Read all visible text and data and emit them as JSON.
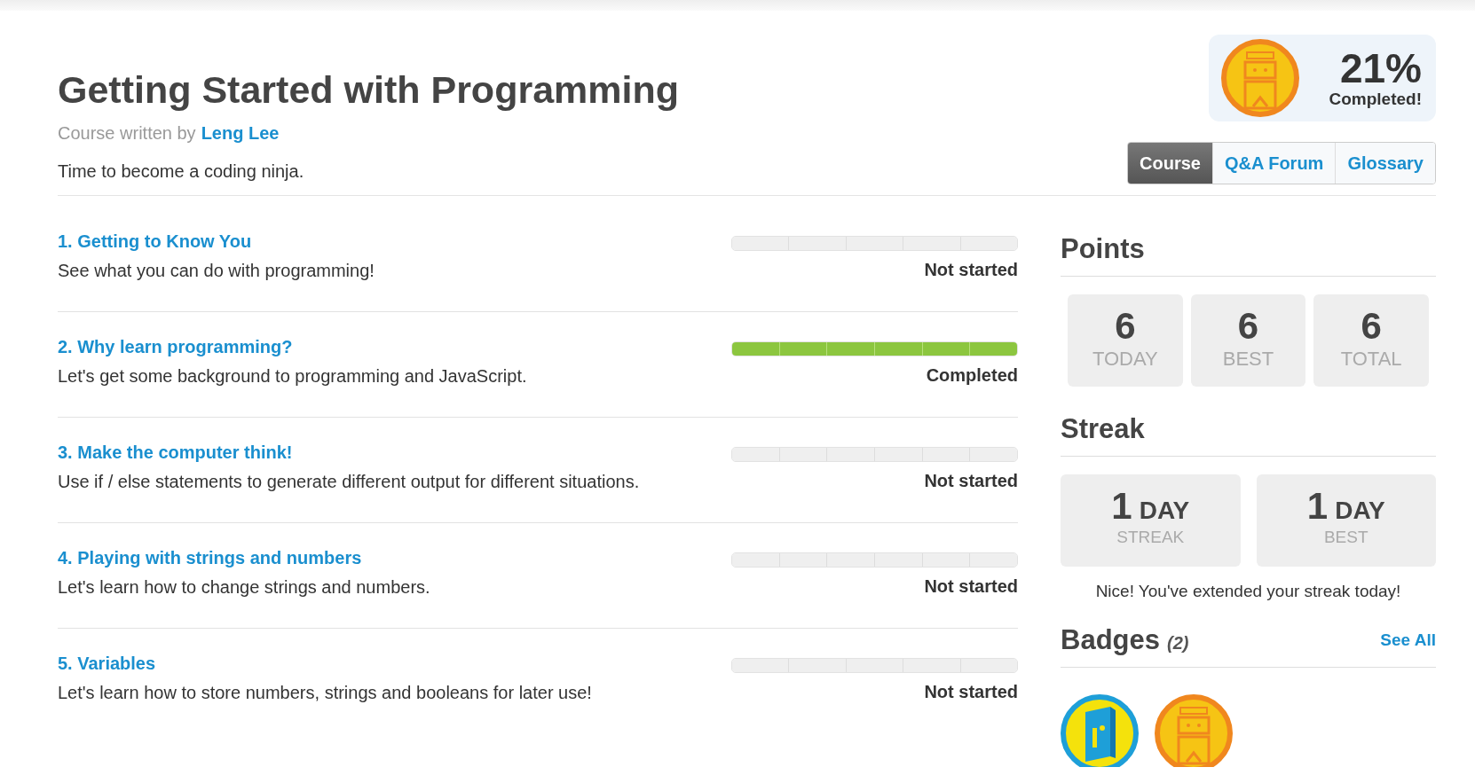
{
  "course": {
    "title": "Getting Started with Programming",
    "author_prefix": "Course written by",
    "author": "Leng Lee",
    "tagline": "Time to become a coding ninja."
  },
  "progress": {
    "percent": "21%",
    "label": "Completed!"
  },
  "tabs": [
    {
      "label": "Course",
      "selected": true
    },
    {
      "label": "Q&A Forum",
      "selected": false
    },
    {
      "label": "Glossary",
      "selected": false
    }
  ],
  "chapters": [
    {
      "title": "1. Getting to Know You",
      "description": "See what you can do with programming!",
      "status": "Not started",
      "steps": [
        {
          "done": false
        },
        {
          "done": false
        },
        {
          "done": false
        },
        {
          "done": false
        },
        {
          "done": false
        }
      ]
    },
    {
      "title": "2. Why learn programming?",
      "description": "Let's get some background to programming and JavaScript.",
      "status": "Completed",
      "steps": [
        {
          "done": true
        },
        {
          "done": true
        },
        {
          "done": true
        },
        {
          "done": true
        },
        {
          "done": true
        },
        {
          "done": true
        }
      ]
    },
    {
      "title": "3. Make the computer think!",
      "description": "Use if / else statements to generate different output for different situations.",
      "status": "Not started",
      "steps": [
        {
          "done": false
        },
        {
          "done": false
        },
        {
          "done": false
        },
        {
          "done": false
        },
        {
          "done": false
        },
        {
          "done": false
        }
      ]
    },
    {
      "title": "4. Playing with strings and numbers",
      "description": "Let's learn how to change strings and numbers.",
      "status": "Not started",
      "steps": [
        {
          "done": false
        },
        {
          "done": false
        },
        {
          "done": false
        },
        {
          "done": false
        },
        {
          "done": false
        },
        {
          "done": false
        }
      ]
    },
    {
      "title": "5. Variables",
      "description": "Let's learn how to store numbers, strings and booleans for later use!",
      "status": "Not started",
      "steps": [
        {
          "done": false
        },
        {
          "done": false
        },
        {
          "done": false
        },
        {
          "done": false
        },
        {
          "done": false
        }
      ]
    }
  ],
  "points": {
    "title": "Points",
    "stats": [
      {
        "value": "6",
        "label": "TODAY"
      },
      {
        "value": "6",
        "label": "BEST"
      },
      {
        "value": "6",
        "label": "TOTAL"
      }
    ]
  },
  "streak": {
    "title": "Streak",
    "stats": [
      {
        "value": "1",
        "unit": "DAY",
        "label": "STREAK"
      },
      {
        "value": "1",
        "unit": "DAY",
        "label": "BEST"
      }
    ],
    "message": "Nice! You've extended your streak today!"
  },
  "badges": {
    "title": "Badges",
    "count": "(2)",
    "see_all": "See All",
    "items": [
      {
        "kind": "book"
      },
      {
        "kind": "robot"
      }
    ]
  }
}
